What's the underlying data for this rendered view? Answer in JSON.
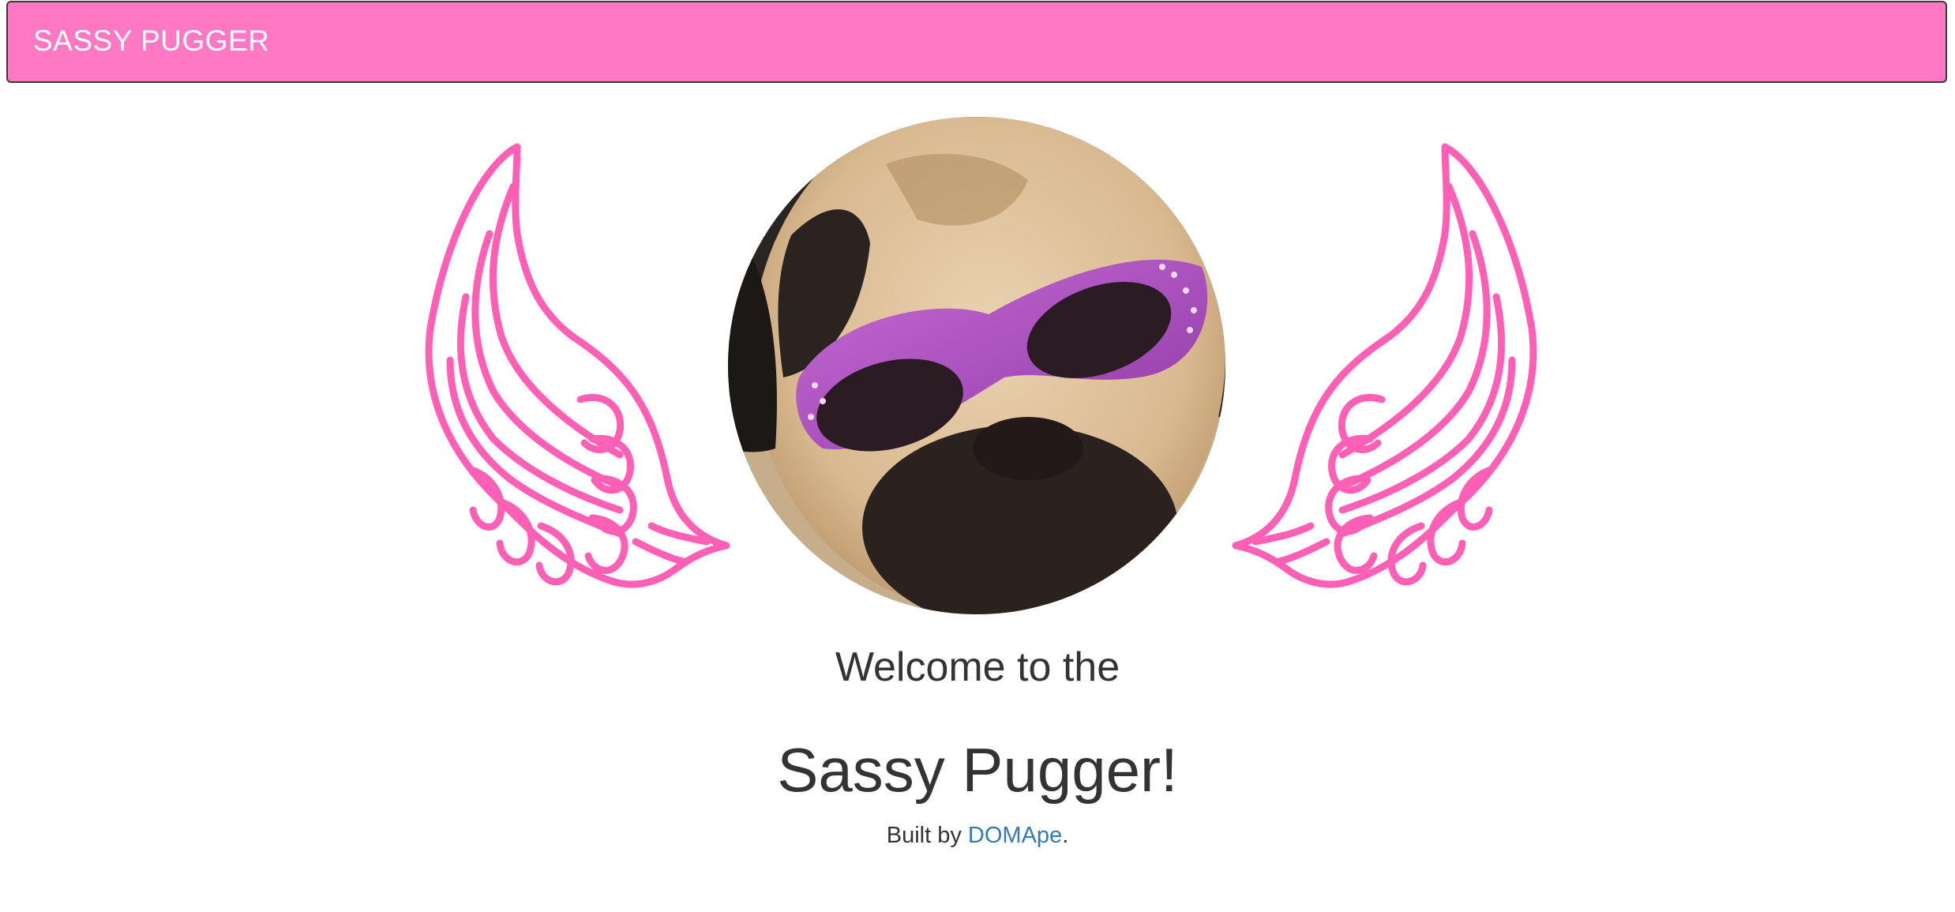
{
  "navbar": {
    "brand": "SASSY PUGGER",
    "color": "#ff78c4"
  },
  "hero": {
    "wing_icon": "angel-wing-icon",
    "wing_color": "#ff5fb4",
    "avatar": "pug-with-purple-sunglasses-photo"
  },
  "welcome": "Welcome to the",
  "title": "Sassy Pugger!",
  "footer": {
    "prefix": "Built by ",
    "link_text": "DOMApe",
    "suffix": ".",
    "link_color": "#337ab7"
  }
}
